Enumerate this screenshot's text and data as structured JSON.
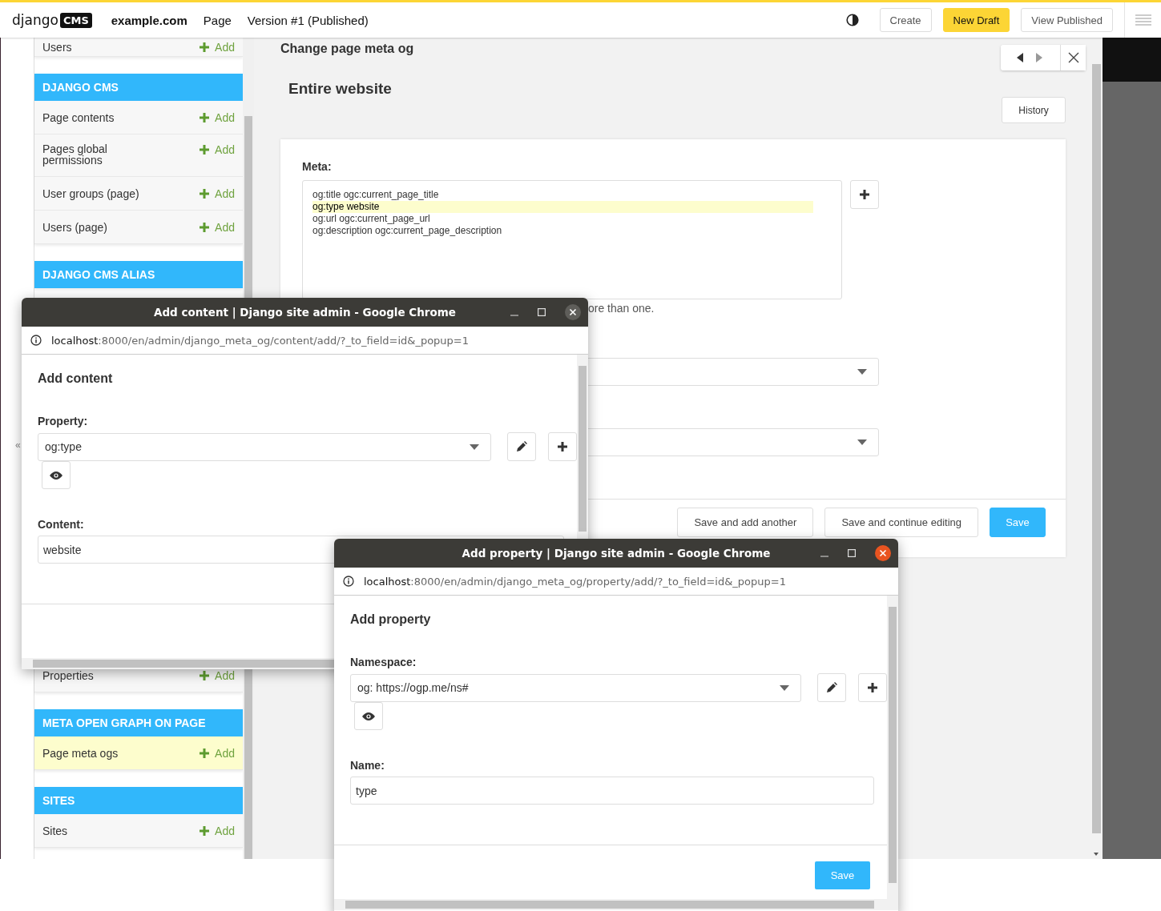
{
  "toolbar": {
    "logo_text": "django",
    "logo_badge": "CMS",
    "site": "example.com",
    "menu": [
      "Page",
      "Version #1 (Published)"
    ],
    "buttons": [
      {
        "label": "Create",
        "kind": "plain"
      },
      {
        "label": "New Draft",
        "kind": "primary"
      },
      {
        "label": "View Published",
        "kind": "plain"
      }
    ]
  },
  "sidebar": {
    "collapse_label": "«",
    "groups": [
      {
        "rows": [
          {
            "label": "Users",
            "add": "Add",
            "selected": false
          }
        ]
      },
      {
        "title": "DJANGO CMS",
        "rows": [
          {
            "label": "Page contents",
            "add": "Add",
            "selected": false
          },
          {
            "label": "Pages global permissions",
            "add": "Add",
            "selected": false
          },
          {
            "label": "User groups (page)",
            "add": "Add",
            "selected": false
          },
          {
            "label": "Users (page)",
            "add": "Add",
            "selected": false
          }
        ]
      },
      {
        "title": "DJANGO CMS ALIAS"
      },
      {
        "rows": [
          {
            "label": "Properties",
            "add": "Add",
            "selected": false
          }
        ]
      },
      {
        "title": "META OPEN GRAPH ON PAGE",
        "rows": [
          {
            "label": "Page meta ogs",
            "add": "Add",
            "selected": true
          }
        ]
      },
      {
        "title": "SITES",
        "rows": [
          {
            "label": "Sites",
            "add": "Add",
            "selected": false
          }
        ]
      }
    ]
  },
  "modal": {
    "title": "Change page meta og",
    "nav": {
      "back_disabled": false,
      "forward_disabled": true
    },
    "heading": "Entire website",
    "history_button": "History",
    "meta_label": "Meta:",
    "meta_options": [
      {
        "text": "og:title ogc:current_page_title",
        "selected": false
      },
      {
        "text": "og:type website",
        "selected": true
      },
      {
        "text": "og:url ogc:current_page_url",
        "selected": false
      },
      {
        "text": "og:description ogc:current_page_description",
        "selected": false
      }
    ],
    "help_text": "ore than one.",
    "footer_buttons": [
      {
        "label": "Save and add another",
        "kind": "default"
      },
      {
        "label": "Save and continue editing",
        "kind": "default"
      },
      {
        "label": "Save",
        "kind": "primary"
      }
    ]
  },
  "windows": [
    {
      "title": "Add content | Django site admin - Google Chrome",
      "active": false,
      "url_host": "localhost",
      "url_path": ":8000/en/admin/django_meta_og/content/add/?_to_field=id&_popup=1",
      "heading": "Add content",
      "fields": [
        {
          "label": "Property:",
          "kind": "select",
          "value": "og:type"
        },
        {
          "label": "Content:",
          "kind": "text",
          "value": "website"
        }
      ]
    },
    {
      "title": "Add property | Django site admin - Google Chrome",
      "active": true,
      "url_host": "localhost",
      "url_path": ":8000/en/admin/django_meta_og/property/add/?_to_field=id&_popup=1",
      "heading": "Add property",
      "fields": [
        {
          "label": "Namespace:",
          "kind": "select",
          "value": "og: https://ogp.me/ns#"
        },
        {
          "label": "Name:",
          "kind": "text",
          "value": "type"
        }
      ],
      "save_button": "Save"
    }
  ]
}
